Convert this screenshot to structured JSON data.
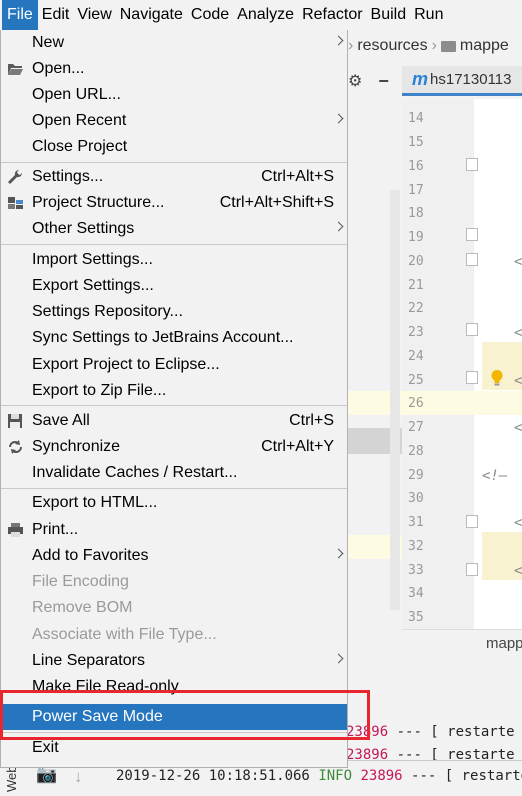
{
  "menubar": {
    "items": [
      "File",
      "Edit",
      "View",
      "Navigate",
      "Code",
      "Analyze",
      "Refactor",
      "Build",
      "Run"
    ]
  },
  "breadcrumb": {
    "items": [
      "resources",
      "mappe"
    ]
  },
  "editor": {
    "tab_label": "hs17130113",
    "tab_icon": "m",
    "line_numbers": [
      "14",
      "15",
      "16",
      "17",
      "18",
      "19",
      "20",
      "21",
      "22",
      "23",
      "24",
      "25",
      "26",
      "27",
      "28",
      "29",
      "30",
      "31",
      "32",
      "33",
      "34",
      "35"
    ],
    "comment_fragment": "<!–",
    "bottom_tab": "mapp"
  },
  "file_menu": {
    "items": [
      {
        "label": "New",
        "mnemonic_label": "New",
        "submenu": true
      },
      {
        "label": "Open...",
        "icon": "folder-open-icon"
      },
      {
        "label": "Open URL..."
      },
      {
        "label": "Open Recent",
        "submenu": true
      },
      {
        "label": "Close Project"
      },
      {
        "label": "Settings...",
        "shortcut": "Ctrl+Alt+S",
        "icon": "wrench-icon"
      },
      {
        "label": "Project Structure...",
        "shortcut": "Ctrl+Alt+Shift+S",
        "icon": "project-structure-icon"
      },
      {
        "label": "Other Settings",
        "submenu": true
      },
      {
        "label": "Import Settings..."
      },
      {
        "label": "Export Settings..."
      },
      {
        "label": "Settings Repository..."
      },
      {
        "label": "Sync Settings to JetBrains Account..."
      },
      {
        "label": "Export Project to Eclipse..."
      },
      {
        "label": "Export to Zip File..."
      },
      {
        "label": "Save All",
        "shortcut": "Ctrl+S",
        "icon": "save-icon"
      },
      {
        "label": "Synchronize",
        "shortcut": "Ctrl+Alt+Y",
        "icon": "sync-icon"
      },
      {
        "label": "Invalidate Caches / Restart..."
      },
      {
        "label": "Export to HTML..."
      },
      {
        "label": "Print...",
        "icon": "printer-icon"
      },
      {
        "label": "Add to Favorites",
        "submenu": true
      },
      {
        "label": "File Encoding",
        "disabled": true
      },
      {
        "label": "Remove BOM",
        "disabled": true
      },
      {
        "label": "Associate with File Type...",
        "disabled": true
      },
      {
        "label": "Line Separators",
        "submenu": true
      },
      {
        "label": "Make File Read-only"
      },
      {
        "label": "Power Save Mode",
        "selected": true
      },
      {
        "label": "Exit"
      }
    ]
  },
  "console": {
    "lines": [
      {
        "pid": "23896",
        "text": " --- [  restarte"
      },
      {
        "pid": "23896",
        "text": " --- [  restarte"
      }
    ],
    "bottom_line": {
      "timestamp": "2019-12-26 10:18:51.066",
      "level": "INFO",
      "pid": "23896",
      "rest": " --- [  restarte"
    },
    "web_tab": "Web"
  },
  "colors": {
    "menu_selected": "#2675bf",
    "highlight_box": "#e8262d",
    "bulb": "#f2b600"
  }
}
